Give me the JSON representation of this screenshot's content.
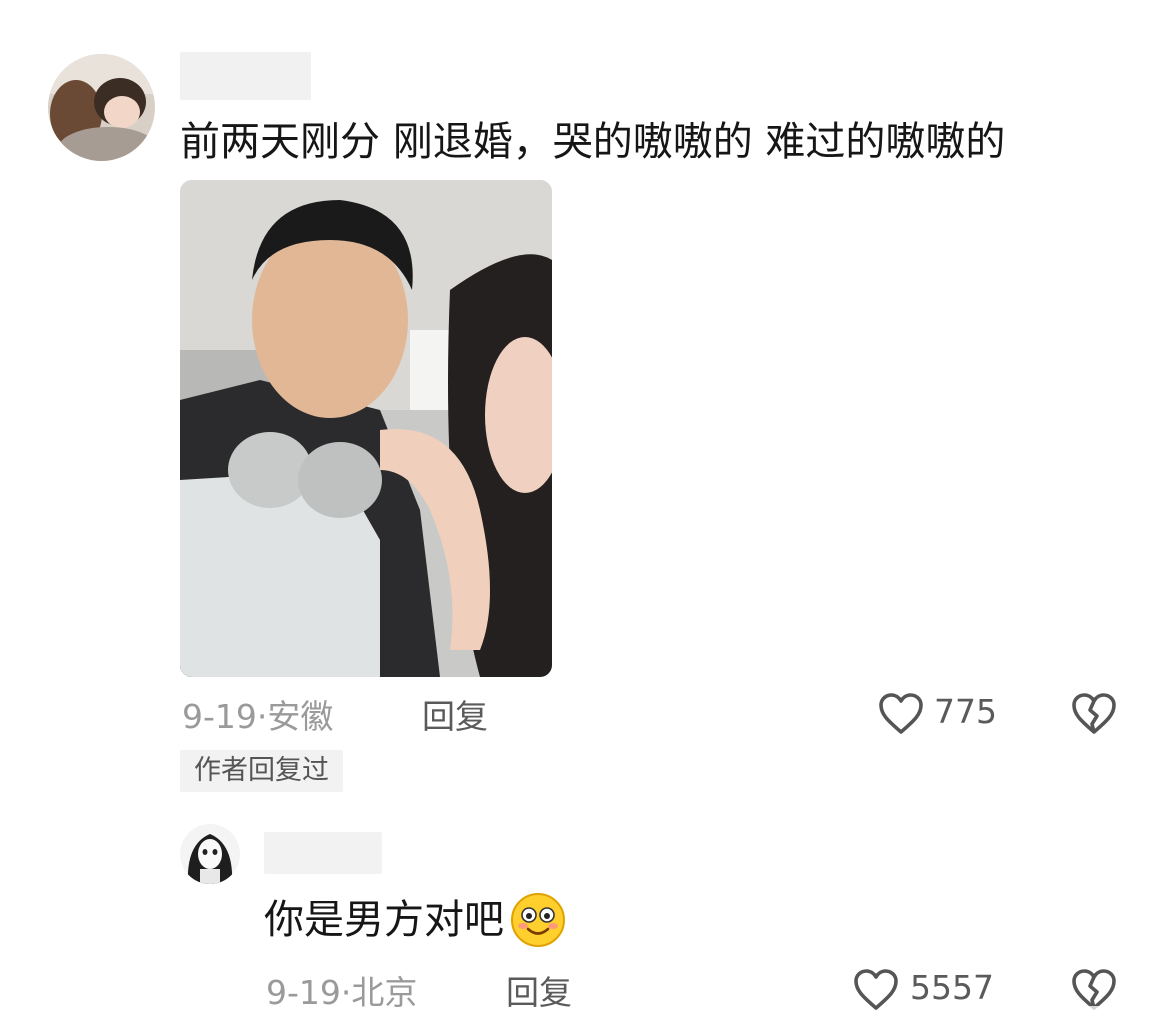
{
  "comments": [
    {
      "text": "前两天刚分 刚退婚，哭的嗷嗷的 难过的嗷嗷的",
      "date": "9-19",
      "location": "安徽",
      "reply_label": "回复",
      "likes": "775",
      "author_replied_badge": "作者回复过"
    },
    {
      "text": "你是男方对吧",
      "date": "9-19",
      "location": "北京",
      "reply_label": "回复",
      "likes": "5557"
    }
  ],
  "icons": {
    "like": "heart-outline-icon",
    "dislike": "broken-heart-icon",
    "emoji": "blush-smile-emoji-icon"
  },
  "colors": {
    "meta_text": "#9a9a9a",
    "action_text": "#5a5a5a",
    "badge_bg": "#f2f2f2",
    "emoji_yellow": "#ffcf2e"
  }
}
